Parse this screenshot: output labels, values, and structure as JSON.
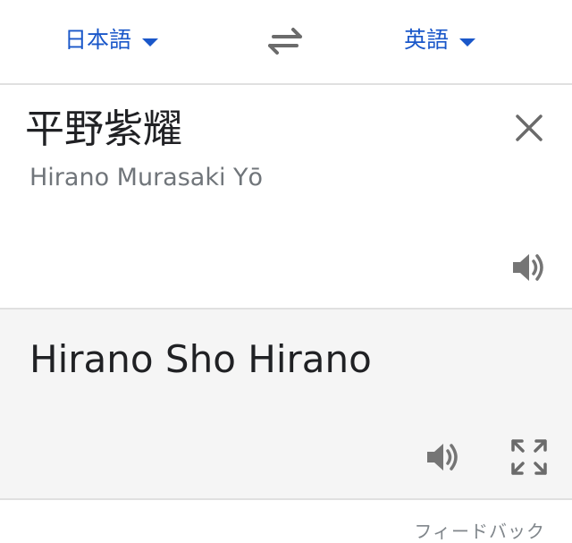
{
  "header": {
    "source_language": "日本語",
    "target_language": "英語",
    "swap_icon": "swap-arrows-icon"
  },
  "source": {
    "text": "平野紫耀",
    "transliteration": "Hirano Murasaki Yō",
    "clear_icon": "close-icon",
    "speaker_icon": "speaker-icon"
  },
  "target": {
    "text": "Hirano Sho Hirano",
    "speaker_icon": "speaker-icon",
    "expand_icon": "fullscreen-icon"
  },
  "footer": {
    "feedback_label": "フィードバック"
  },
  "colors": {
    "accent": "#1a57c9",
    "icon": "#757575",
    "target_background": "#f5f5f5",
    "divider": "#e0e0e0"
  }
}
